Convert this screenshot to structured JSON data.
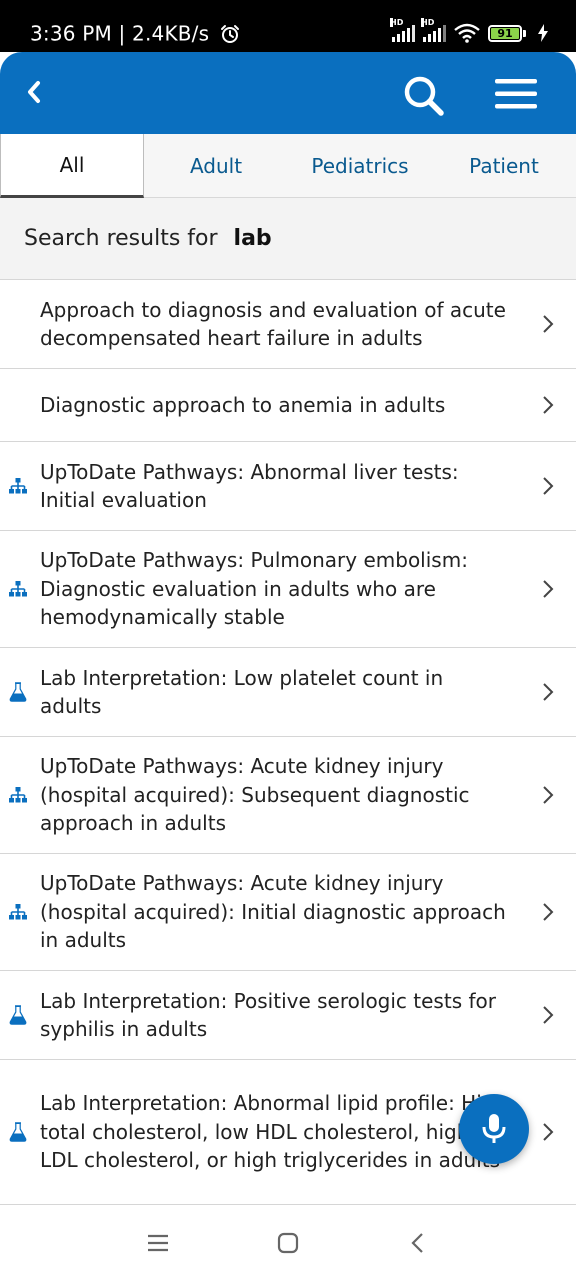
{
  "status_bar": {
    "time": "3:36 PM | 2.4KB/s",
    "battery": "91",
    "icons": [
      "alarm-icon",
      "signal-hd-icon",
      "signal-hd-icon",
      "wifi-icon",
      "battery-icon",
      "charging-icon"
    ]
  },
  "app_bar": {
    "icons": [
      "back-icon",
      "search-icon",
      "hamburger-menu-icon"
    ],
    "color": "#0a6fbf"
  },
  "tabs": [
    {
      "label": "All",
      "active": true
    },
    {
      "label": "Adult",
      "active": false
    },
    {
      "label": "Pediatrics",
      "active": false
    },
    {
      "label": "Patient",
      "active": false
    }
  ],
  "search": {
    "prefix": "Search results for",
    "query": "lab"
  },
  "results": [
    {
      "title": "Approach to diagnosis and evaluation of acute decompensated heart failure in adults",
      "icon": ""
    },
    {
      "title": "Diagnostic approach to anemia in adults",
      "icon": ""
    },
    {
      "title": "UpToDate Pathways: Abnormal liver tests: Initial evaluation",
      "icon": "pathway-icon"
    },
    {
      "title": "UpToDate Pathways: Pulmonary embolism: Diagnostic evaluation in adults who are hemodynamically stable",
      "icon": "pathway-icon"
    },
    {
      "title": "Lab Interpretation: Low platelet count in adults",
      "icon": "lab-flask-icon"
    },
    {
      "title": "UpToDate Pathways: Acute kidney injury (hospital acquired): Subsequent diagnostic approach in adults",
      "icon": "pathway-icon"
    },
    {
      "title": "UpToDate Pathways: Acute kidney injury (hospital acquired): Initial diagnostic approach in adults",
      "icon": "pathway-icon"
    },
    {
      "title": "Lab Interpretation: Positive serologic tests for syphilis in adults",
      "icon": "lab-flask-icon"
    },
    {
      "title": "Lab Interpretation: Abnormal lipid profile: High total cholesterol, low HDL cholesterol, high LDL cholesterol, or high triglycerides in adults",
      "icon": "lab-flask-icon"
    }
  ],
  "fab": {
    "icon": "microphone-icon"
  },
  "nav_bar": {
    "icons": [
      "recents-icon",
      "home-icon",
      "back-nav-icon"
    ]
  }
}
